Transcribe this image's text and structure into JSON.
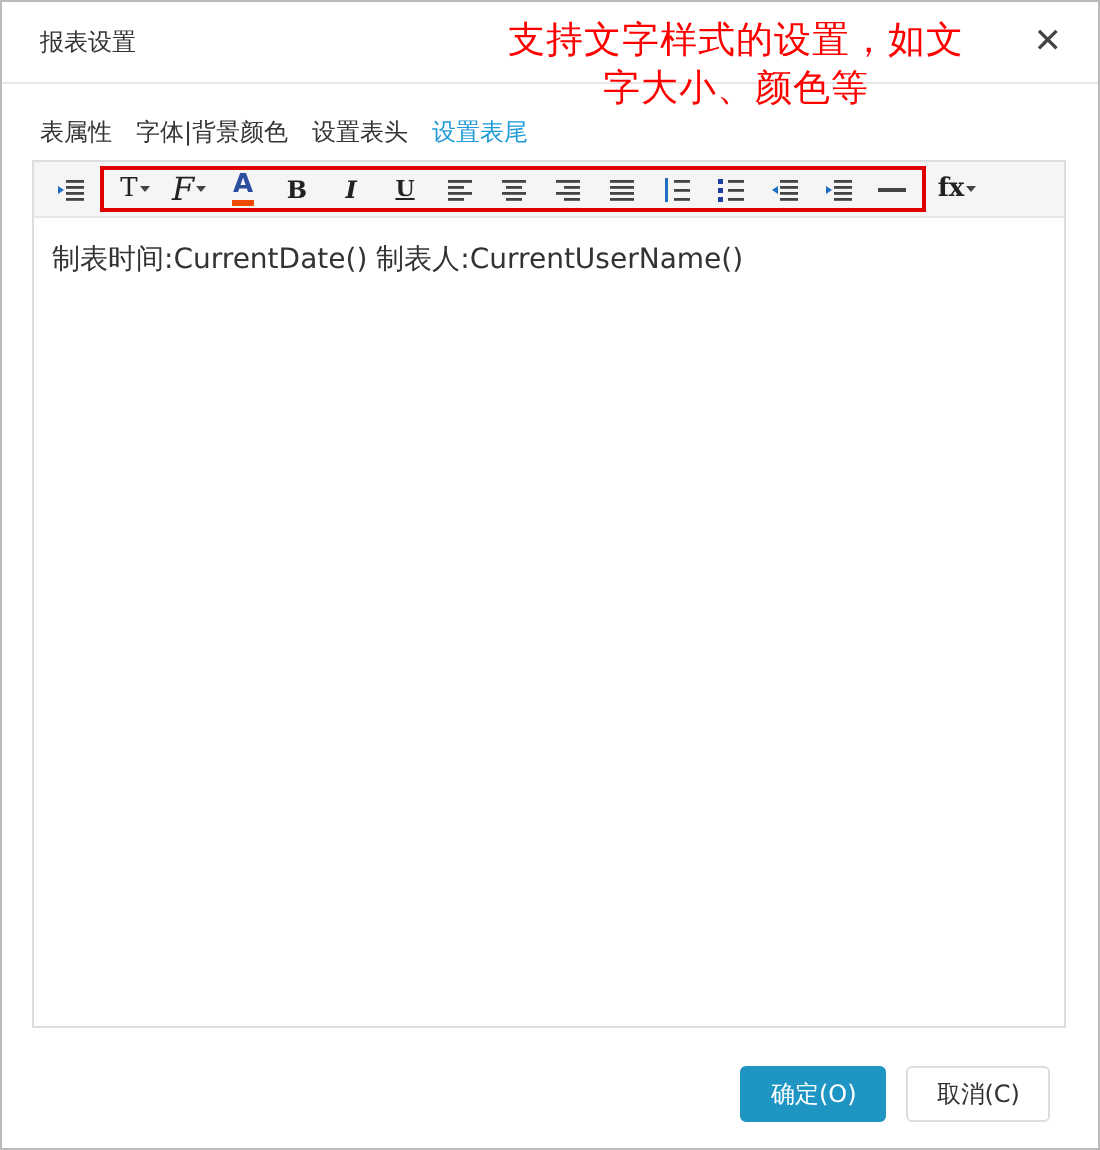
{
  "window": {
    "title": "报表设置",
    "close": "✕"
  },
  "annotation": {
    "text": "支持文字样式的设置，如文字大小、颜色等"
  },
  "tabs": [
    {
      "label": "表属性",
      "selected": false
    },
    {
      "label": "字体|背景颜色",
      "selected": false
    },
    {
      "label": "设置表头",
      "selected": false
    },
    {
      "label": "设置表尾",
      "selected": true
    }
  ],
  "toolbar": {
    "leading": [
      {
        "kind": "indent"
      }
    ],
    "highlighted": [
      {
        "kind": "fontsize",
        "label": "T"
      },
      {
        "kind": "font",
        "label": "F"
      },
      {
        "kind": "color",
        "label": "A"
      },
      {
        "kind": "bold",
        "label": "B"
      },
      {
        "kind": "italic",
        "label": "I"
      },
      {
        "kind": "underline",
        "label": "U"
      },
      {
        "kind": "align-left"
      },
      {
        "kind": "align-center"
      },
      {
        "kind": "align-right"
      },
      {
        "kind": "justify"
      },
      {
        "kind": "ordered-list"
      },
      {
        "kind": "bullet-list"
      },
      {
        "kind": "outdent"
      },
      {
        "kind": "indent"
      },
      {
        "kind": "rule"
      }
    ],
    "trailing": [
      {
        "kind": "formula",
        "label": "fx"
      }
    ]
  },
  "editor": {
    "content": "制表时间:CurrentDate() 制表人:CurrentUserName()"
  },
  "buttons": [
    {
      "label": "确定(O)",
      "kind": "primary"
    },
    {
      "label": "取消(C)",
      "kind": "secondary"
    }
  ]
}
